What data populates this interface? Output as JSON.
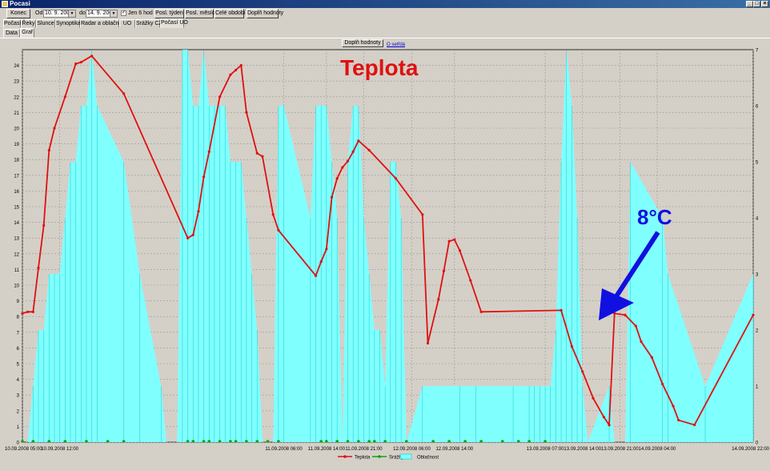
{
  "window": {
    "title": "Pocasi",
    "minimize": "_",
    "maximize": "□",
    "close": "×"
  },
  "toolbar": {
    "konec": "Konec",
    "od_label": "Od",
    "od_value": "10. 9. 2008",
    "do_label": "do",
    "do_value": "14. 9. 2008",
    "jen6_checked": "✓",
    "jen6_label": "Jen 6 hod",
    "posl_tyden": "Posl. týden",
    "posl_mesic": "Posl. měsíc",
    "cele_obdobi": "Celé období",
    "doplnit": "Doplň hodnoty"
  },
  "tabs": [
    "Počasí",
    "Řeky",
    "Slunce",
    "Synoptika",
    "Radar a oblačnost",
    "UO",
    "Srážky CZ",
    "Počasí UO"
  ],
  "subtabs": [
    "Data",
    "Graf"
  ],
  "chart_panel": {
    "button": "Doplň hodnoty",
    "link": "O setřdá"
  },
  "annotations": {
    "title": "Teplota",
    "callout": "8°C",
    "title_color": "#e01010",
    "callout_color": "#1010e0"
  },
  "colors": {
    "temp": "#e01010",
    "precip": "#10a010",
    "cloud": "#80ffff",
    "cloud_line": "#00c0c0"
  },
  "chart_data": {
    "type": "line",
    "title": "Teplota",
    "x_ticks": [
      "10.09.2008 05:00",
      "10.09.2008 12:00",
      "11.09.2008 06:00",
      "11.09.2008 14:00",
      "11.09.2008 21:00",
      "12.09.2008 06:00",
      "12.09.2008 14:00",
      "13.09.2008 07:00",
      "13.09.2008 14:00",
      "13.09.2008 21:00",
      "14.09.2008 04:00",
      "14.09.2008 22:00"
    ],
    "x_tick_hours": [
      5,
      12,
      54,
      62,
      69,
      78,
      86,
      103,
      110,
      117,
      124,
      142
    ],
    "xlim": [
      5,
      142
    ],
    "ylim_left": [
      0,
      25
    ],
    "yticks_left": [
      0,
      1,
      2,
      3,
      4,
      5,
      6,
      7,
      8,
      9,
      10,
      11,
      12,
      13,
      14,
      15,
      16,
      17,
      18,
      19,
      20,
      21,
      22,
      23,
      24
    ],
    "ylim_right": [
      0,
      7
    ],
    "yticks_right": [
      0,
      1,
      2,
      3,
      4,
      5,
      6,
      7
    ],
    "grid": true,
    "legend": [
      "Teplota",
      "Srážky",
      "Oblačnost"
    ],
    "legend_position": "bottom",
    "series": [
      {
        "name": "Teplota",
        "axis": "left",
        "x": [
          5,
          6,
          7,
          8,
          9,
          10,
          11,
          13,
          15,
          16,
          18,
          24,
          36,
          37,
          38,
          39,
          40,
          42,
          44,
          45,
          46,
          47,
          49,
          50,
          52,
          53,
          60,
          61,
          62,
          63,
          64,
          65,
          66,
          67,
          68,
          70,
          75,
          80,
          81,
          83,
          84,
          85,
          86,
          87,
          89,
          91,
          106,
          108,
          110,
          112,
          114,
          115,
          116,
          118,
          120,
          121,
          123,
          125,
          127,
          128,
          131,
          142
        ],
        "y": [
          8.2,
          8.3,
          8.3,
          11.1,
          13.8,
          18.6,
          20.0,
          22.0,
          24.1,
          24.2,
          24.6,
          22.2,
          13.0,
          13.2,
          14.7,
          16.9,
          18.5,
          22.0,
          23.4,
          23.7,
          24.0,
          21.0,
          18.4,
          18.2,
          14.5,
          13.5,
          10.6,
          11.5,
          12.3,
          15.6,
          16.8,
          17.5,
          17.9,
          18.5,
          19.2,
          18.6,
          16.8,
          14.5,
          6.3,
          9.1,
          10.9,
          12.8,
          12.9,
          12.2,
          10.3,
          8.3,
          8.4,
          6.1,
          4.5,
          2.8,
          1.6,
          1.1,
          8.2,
          8.1,
          7.4,
          6.4,
          5.4,
          3.7,
          2.3,
          1.4,
          1.1,
          8.1
        ]
      },
      {
        "name": "Srážky",
        "axis": "right",
        "x": [
          5,
          7,
          10,
          13,
          17,
          21,
          24,
          36,
          37,
          39,
          40,
          42,
          44,
          45,
          47,
          49,
          51,
          53,
          61,
          62,
          64,
          66,
          68,
          70,
          71,
          73,
          77,
          82,
          85,
          88,
          91,
          95,
          98,
          100,
          103
        ],
        "y": [
          0,
          0,
          0,
          0,
          0,
          0,
          0,
          0,
          0,
          0,
          0,
          0,
          0,
          0,
          0,
          0,
          0,
          0,
          0,
          0,
          0,
          0,
          0,
          0,
          0,
          0,
          0,
          0,
          0,
          0,
          0,
          0,
          0,
          0,
          0
        ]
      },
      {
        "name": "Oblačnost",
        "axis": "right",
        "x": [
          5,
          6,
          7,
          8,
          9,
          10,
          11,
          12,
          13,
          14,
          15,
          16,
          17,
          18,
          19,
          24,
          27,
          31,
          32,
          33,
          34,
          35,
          36,
          37,
          38,
          39,
          40,
          41,
          42,
          43,
          44,
          45,
          46,
          47,
          48,
          49,
          50,
          51,
          52,
          53,
          54,
          59,
          60,
          61,
          62,
          63,
          64,
          65,
          66,
          67,
          68,
          69,
          70,
          71,
          72,
          73,
          74,
          75,
          76,
          77,
          80,
          87,
          90,
          97,
          100,
          101,
          102,
          103,
          104,
          105,
          106,
          107,
          108,
          109,
          110,
          111,
          115,
          116,
          117,
          118,
          119,
          125,
          126,
          133,
          142
        ],
        "y": [
          0,
          0,
          1,
          2,
          2,
          3,
          3,
          3,
          4,
          5,
          5,
          6,
          6,
          7,
          6,
          5,
          3,
          1,
          0,
          0,
          0,
          7,
          7,
          6,
          6,
          7,
          6,
          6,
          6,
          6,
          5,
          5,
          5,
          4,
          3,
          2,
          0,
          0,
          0,
          6,
          6,
          4,
          6,
          6,
          6,
          5,
          4,
          0,
          5,
          6,
          6,
          4,
          3,
          2,
          2,
          1,
          5,
          5,
          4,
          0,
          1,
          1,
          1,
          1,
          1,
          1,
          1,
          1,
          1,
          2,
          5,
          7,
          6,
          4,
          1,
          0,
          1,
          0,
          0,
          0,
          5,
          4,
          3,
          1,
          3
        ]
      }
    ]
  }
}
